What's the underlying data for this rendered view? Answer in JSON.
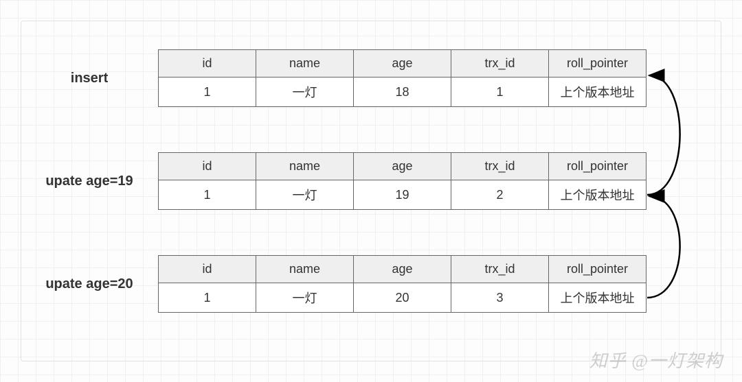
{
  "headers": [
    "id",
    "name",
    "age",
    "trx_id",
    "roll_pointer"
  ],
  "rows": [
    {
      "label": "insert",
      "cells": [
        "1",
        "一灯",
        "18",
        "1",
        "上个版本地址"
      ]
    },
    {
      "label": "upate age=19",
      "cells": [
        "1",
        "一灯",
        "19",
        "2",
        "上个版本地址"
      ]
    },
    {
      "label": "upate age=20",
      "cells": [
        "1",
        "一灯",
        "20",
        "3",
        "上个版本地址"
      ]
    }
  ],
  "watermark": "知乎 @一灯架构"
}
